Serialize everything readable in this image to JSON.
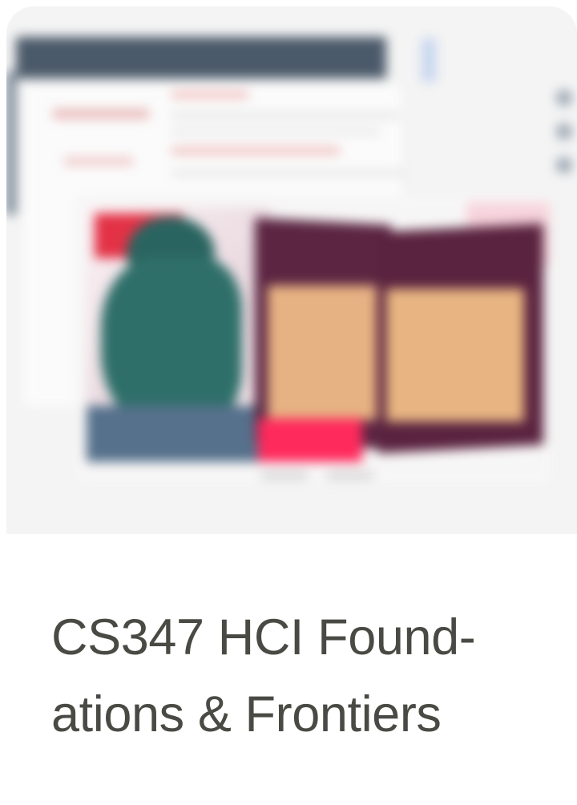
{
  "card": {
    "thumbnail": {
      "description_icon": "course-cover-thumbnail"
    },
    "title_line1": "CS347 HCI Found-",
    "title_line2": "ations & Frontiers"
  },
  "colors": {
    "title_text": "#4a4a45",
    "thumbnail_background": "#f4f4f4"
  }
}
